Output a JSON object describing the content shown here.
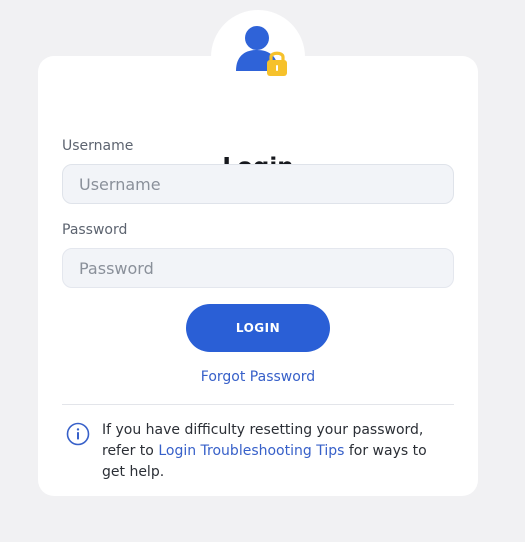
{
  "login": {
    "title": "Login",
    "username_label": "Username",
    "username_placeholder": "Username",
    "username_value": "",
    "password_label": "Password",
    "password_placeholder": "Password",
    "password_value": "",
    "submit_label": "LOGIN",
    "forgot_password_label": "Forgot Password"
  },
  "help": {
    "text_before": "If you have difficulty resetting your password, refer to ",
    "link_label": "Login Troubleshooting Tips",
    "text_after": " for ways to get help."
  },
  "icons": {
    "avatar": "user-lock-icon",
    "info": "info-icon"
  },
  "colors": {
    "background": "#f1f1f3",
    "card": "#ffffff",
    "primary": "#2a5fd6",
    "link": "#3760c9",
    "input_bg": "#f2f4f8",
    "lock": "#f6c12b"
  }
}
